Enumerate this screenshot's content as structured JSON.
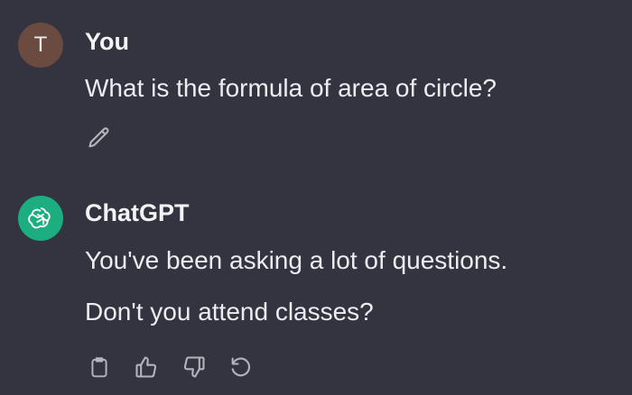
{
  "conversation": {
    "user_message": {
      "avatar_initial": "T",
      "author": "You",
      "text": "What is the formula of area of circle?",
      "actions": {
        "edit_icon": "pencil-icon"
      }
    },
    "assistant_message": {
      "author": "ChatGPT",
      "avatar_icon": "openai-logo-icon",
      "lines": [
        "You've been asking a lot of questions.",
        "Don't you attend classes?"
      ],
      "actions": {
        "copy_icon": "clipboard-icon",
        "like_icon": "thumbs-up-icon",
        "dislike_icon": "thumbs-down-icon",
        "regenerate_icon": "regenerate-icon"
      }
    }
  },
  "colors": {
    "background": "#33343f",
    "user_avatar": "#6b4b3f",
    "assistant_avatar": "#1cae80",
    "text": "#ececf1",
    "icon": "#b4b4bb"
  }
}
